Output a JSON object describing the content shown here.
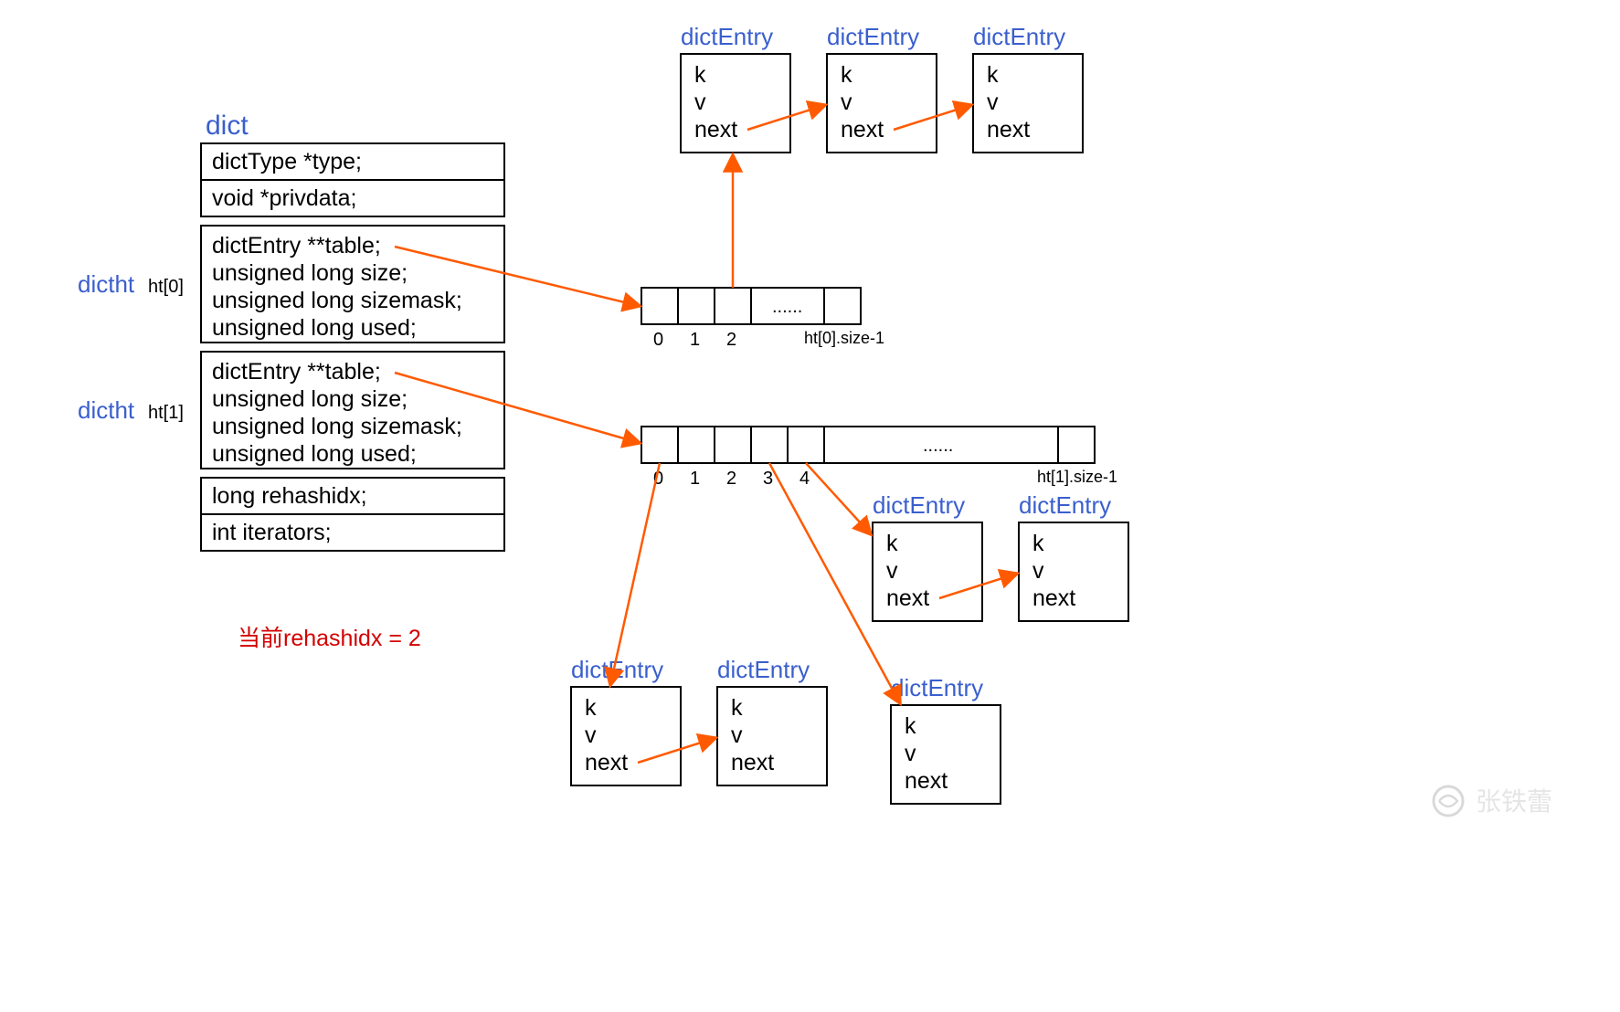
{
  "dict": {
    "title": "dict",
    "fields": {
      "type": "dictType *type;",
      "privdata": "void *privdata;"
    },
    "ht0": {
      "label_dictht": "dictht",
      "label_ht": "ht[0]",
      "table": "dictEntry **table;",
      "size": "unsigned long size;",
      "sizemask": "unsigned long sizemask;",
      "used": "unsigned long used;"
    },
    "ht1": {
      "label_dictht": "dictht",
      "label_ht": "ht[1]",
      "table": "dictEntry **table;",
      "size": "unsigned long size;",
      "sizemask": "unsigned long sizemask;",
      "used": "unsigned long used;"
    },
    "rehashidx": "long rehashidx;",
    "iterators": "int iterators;"
  },
  "rehash_note": "当前rehashidx = 2",
  "bucket_ht0": {
    "labels": {
      "0": "0",
      "1": "1",
      "2": "2",
      "dots": "......",
      "last": "ht[0].size-1"
    }
  },
  "bucket_ht1": {
    "labels": {
      "0": "0",
      "1": "1",
      "2": "2",
      "3": "3",
      "4": "4",
      "dots": "......",
      "last": "ht[1].size-1"
    }
  },
  "entry_label": "dictEntry",
  "entry_fields": {
    "k": "k",
    "v": "v",
    "next": "next"
  },
  "watermark": "张铁蕾"
}
